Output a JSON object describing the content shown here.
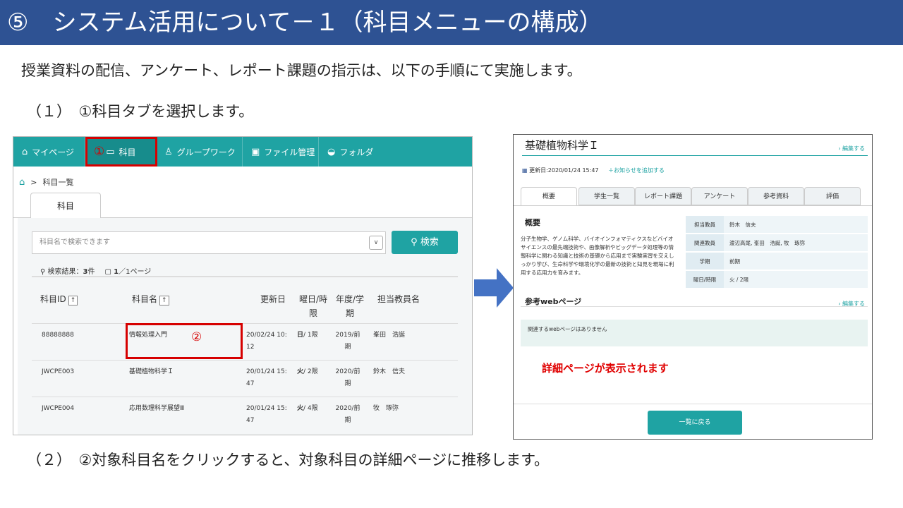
{
  "slide": {
    "title": "⑤　システム活用について－１（科目メニューの構成）",
    "intro": "授業資料の配信、アンケート、レポート課題の指示は、以下の手順にて実施します。",
    "step1": "（１）　①科目タブを選択します。",
    "step2": "（２）　②対象科目名をクリックすると、対象科目の詳細ページに推移します。"
  },
  "left_screen": {
    "nav": [
      {
        "icon": "home-icon",
        "glyph": "⌂",
        "label": "マイページ"
      },
      {
        "icon": "course-icon",
        "glyph": "▭",
        "label": "科目"
      },
      {
        "icon": "group-icon",
        "glyph": "♙",
        "label": "グループワーク"
      },
      {
        "icon": "file-icon",
        "glyph": "▣",
        "label": "ファイル管理"
      },
      {
        "icon": "folder-icon",
        "glyph": "◒",
        "label": "フォルダ"
      }
    ],
    "marker1": "①",
    "marker2": "②",
    "breadcrumb": {
      "home_glyph": "⌂",
      "sep": ">",
      "current": "科目一覧"
    },
    "subtab": "科目",
    "search": {
      "placeholder": "科目名で検索できます",
      "dropdown_glyph": "∨",
      "button_icon": "⚲",
      "button_label": "検索"
    },
    "result": {
      "icon1": "⚲",
      "label": "検索結果：",
      "count": "3",
      "count_unit": "件",
      "icon2": "▢",
      "page": "1",
      "pages": "／1ページ"
    },
    "columns": {
      "id": "科目ID",
      "name": "科目名",
      "sort_glyph": "↑",
      "updated": "更新日",
      "day_period": "曜日/時\n限",
      "year_term": "年度/学\n期",
      "teacher": "担当教員名"
    },
    "rows": [
      {
        "id": "88888888",
        "name": "情報処理入門",
        "updated": "20/02/24 10:\n12",
        "day": "日",
        "period": "/ 1限",
        "year": "2019/前\n期",
        "teacher": "峯田　浩誕"
      },
      {
        "id": "JWCPE003",
        "name": "基礎植物科学Ｉ",
        "updated": "20/01/24 15:\n47",
        "day": "火",
        "period": "/ 2限",
        "year": "2020/前\n期",
        "teacher": "鈴木　信夫"
      },
      {
        "id": "JWCPE004",
        "name": "応用数理科学展望Ⅲ",
        "updated": "20/01/24 15:\n47",
        "day": "火",
        "period": "/ 4限",
        "year": "2020/前\n期",
        "teacher": "牧　琢弥"
      }
    ]
  },
  "right_screen": {
    "title": "基礎植物科学Ｉ",
    "edit_link": "› 編集する",
    "updated": "更新日:2020/01/24 15:47",
    "calendar_glyph": "▦",
    "add_news": "＋お知らせを追加する",
    "tabs": [
      "概要",
      "学生一覧",
      "レポート課題",
      "アンケート",
      "参考資料",
      "評価"
    ],
    "overview_heading": "概要",
    "description": "分子生物学、ゲノム科学、バイオインフォマティクスなどバイオサイエンスの最先端技術や、画像解析やビッグデータ処理等の情報科学に関わる知識と技術の基礎から応用まで実験実習を交えしっかり学び、生命科学や環境化学の最新の技術と知見を現場に利用する応用力を育みます。",
    "info": [
      {
        "k": "担当教員",
        "v": "鈴木　信夫"
      },
      {
        "k": "関連教員",
        "v": "渡辺高尾, 峯田　浩誕, 牧　琢弥"
      },
      {
        "k": "学期",
        "v": "前期"
      },
      {
        "k": "曜日/時限",
        "v": "火 / 2限"
      }
    ],
    "web_heading": "参考webページ",
    "web_edit": "› 編集する",
    "web_empty": "関連するwebページはありません",
    "notice": "詳細ページが表示されます",
    "back_button": "一覧に戻る"
  },
  "colors": {
    "title_bar": "#2e5293",
    "teal": "#1fa3a3",
    "highlight_red": "#d60000",
    "arrow": "#4472c4"
  }
}
